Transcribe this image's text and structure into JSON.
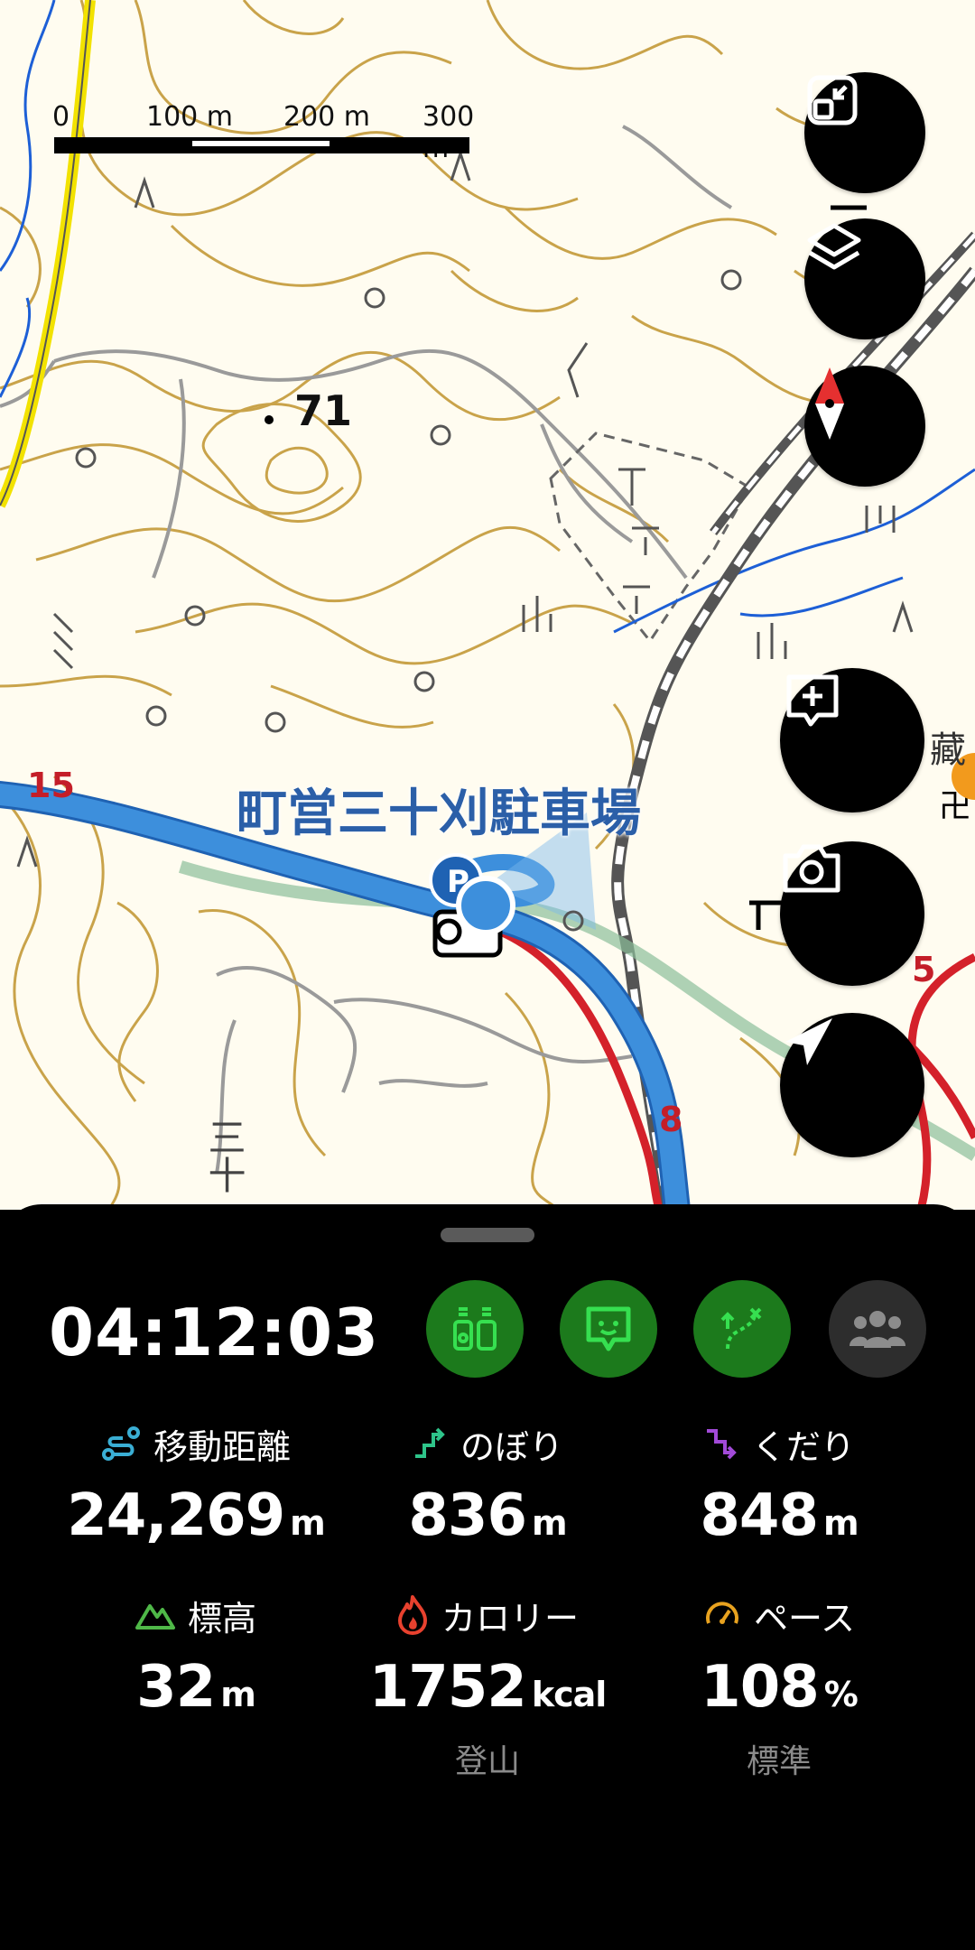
{
  "map": {
    "scale_labels": [
      "0",
      "100 m",
      "200 m",
      "300 m"
    ],
    "elevation_point": "71",
    "parking_label": "町営三十刈駐車場",
    "route_markers": [
      "15",
      "8",
      "5"
    ],
    "area_label_partial": "三十",
    "poi_label_partial": "藏"
  },
  "controls": {
    "icons": [
      "fullscreen-exit-icon",
      "layers-icon",
      "compass-icon",
      "add-memo-icon",
      "camera-icon",
      "my-location-icon"
    ]
  },
  "panel": {
    "elapsed_time": "04:12:03",
    "quick_buttons": [
      "binoculars-icon",
      "chat-bubble-icon",
      "route-plan-icon",
      "group-icon"
    ],
    "stats": {
      "distance": {
        "label": "移動距離",
        "value": "24,269",
        "unit": "m"
      },
      "ascent": {
        "label": "のぼり",
        "value": "836",
        "unit": "m"
      },
      "descent": {
        "label": "くだり",
        "value": "848",
        "unit": "m"
      },
      "altitude": {
        "label": "標高",
        "value": "32",
        "unit": "m"
      },
      "calories": {
        "label": "カロリー",
        "value": "1752",
        "unit": "kcal",
        "sub": "登山"
      },
      "pace": {
        "label": "ペース",
        "value": "108",
        "unit": "%",
        "sub": "標準"
      }
    }
  },
  "colors": {
    "route_blue": "#3d8fdc",
    "route_red": "#d4212a",
    "contour": "#c9a34a",
    "accent_green": "#1c7a1c"
  }
}
